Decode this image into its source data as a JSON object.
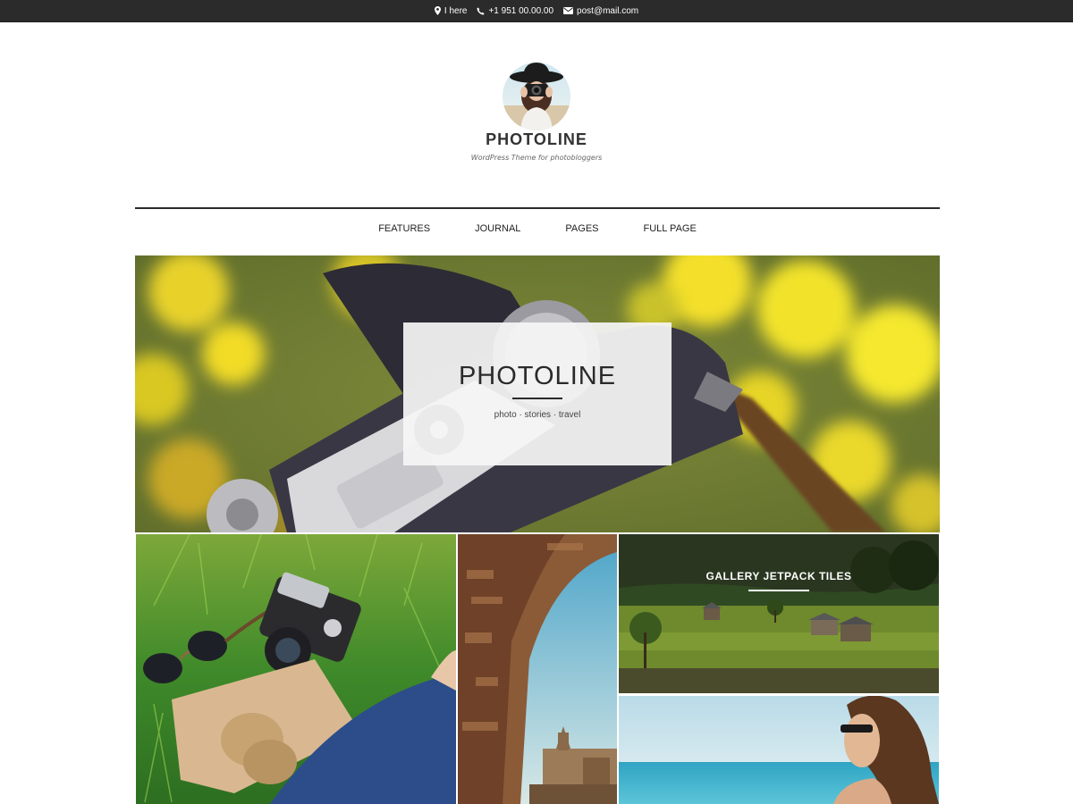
{
  "topbar": {
    "location": "I here",
    "phone": "+1 951 00.00.00",
    "email": "post@mail.com"
  },
  "header": {
    "title": "PHOTOLINE",
    "description": "WordPress Theme for photobloggers"
  },
  "nav": {
    "items": [
      "FEATURES",
      "JOURNAL",
      "PAGES",
      "FULL PAGE"
    ]
  },
  "hero": {
    "title": "PHOTOLINE",
    "subtitle": "photo · stories · travel"
  },
  "tiles": {
    "gallery_title": "GALLERY JETPACK TILES"
  },
  "colors": {
    "topbar_bg": "#2b2b2b",
    "accent_dark": "#2a2a2a"
  },
  "icons": [
    "map-marker-icon",
    "phone-icon",
    "envelope-icon"
  ]
}
